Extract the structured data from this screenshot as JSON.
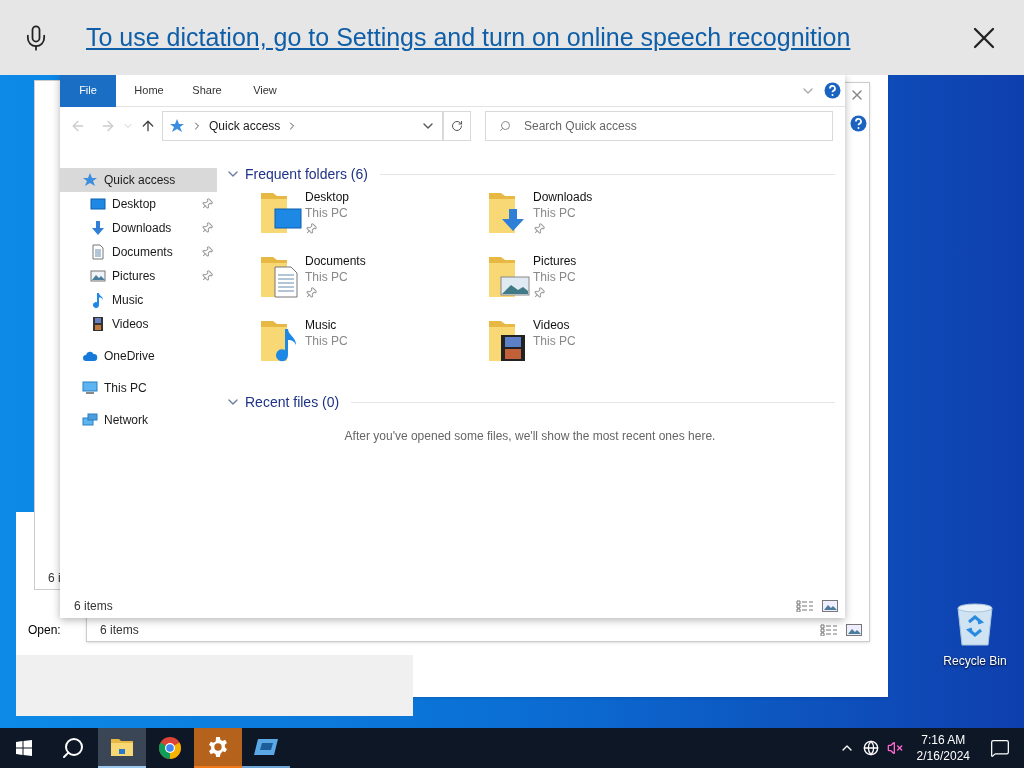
{
  "dictation_bar": {
    "message": "To use dictation, go to Settings and turn on online speech recognition"
  },
  "explorer": {
    "ribbon_tabs": [
      {
        "label": "File",
        "selected": true
      },
      {
        "label": "Home",
        "selected": false
      },
      {
        "label": "Share",
        "selected": false
      },
      {
        "label": "View",
        "selected": false
      }
    ],
    "address": {
      "crumb": "Quick access"
    },
    "search": {
      "placeholder": "Search Quick access"
    },
    "nav": [
      {
        "label": "Quick access",
        "kind": "star",
        "selected": true,
        "children": [
          {
            "label": "Desktop",
            "kind": "desktop",
            "pinned": true,
            "selected": false
          },
          {
            "label": "Downloads",
            "kind": "downloads",
            "pinned": true,
            "selected": false
          },
          {
            "label": "Documents",
            "kind": "documents",
            "pinned": true,
            "selected": false
          },
          {
            "label": "Pictures",
            "kind": "pictures",
            "pinned": true,
            "selected": false
          },
          {
            "label": "Music",
            "kind": "music",
            "pinned": false,
            "selected": false
          },
          {
            "label": "Videos",
            "kind": "videos",
            "pinned": false,
            "selected": false
          }
        ]
      },
      {
        "label": "OneDrive",
        "kind": "cloud",
        "selected": false
      },
      {
        "label": "This PC",
        "kind": "pc",
        "selected": false
      },
      {
        "label": "Network",
        "kind": "network",
        "selected": false
      }
    ],
    "sections": [
      {
        "title": "Frequent folders (6)",
        "expanded": true,
        "folders": [
          {
            "name": "Desktop",
            "location": "This PC",
            "pinned": true,
            "kind": "desktop"
          },
          {
            "name": "Downloads",
            "location": "This PC",
            "pinned": true,
            "kind": "downloads"
          },
          {
            "name": "Documents",
            "location": "This PC",
            "pinned": true,
            "kind": "documents"
          },
          {
            "name": "Pictures",
            "location": "This PC",
            "pinned": true,
            "kind": "pictures"
          },
          {
            "name": "Music",
            "location": "This PC",
            "pinned": false,
            "kind": "music"
          },
          {
            "name": "Videos",
            "location": "This PC",
            "pinned": false,
            "kind": "videos"
          }
        ]
      },
      {
        "title": "Recent files (0)",
        "expanded": true,
        "empty_message": "After you've opened some files, we'll show the most recent ones here."
      }
    ],
    "status": "6 items"
  },
  "back_explorer": {
    "status": "6 items"
  },
  "third_window": {
    "status": "6 i"
  },
  "run_dialog": {
    "open_label": "Open:"
  },
  "desktop_icons": [
    {
      "label": "Recycle Bin"
    }
  ],
  "taskbar": {
    "apps": [
      {
        "kind": "explorer",
        "running": true,
        "active": true,
        "attention": false
      },
      {
        "kind": "chrome",
        "running": false,
        "active": false,
        "attention": false
      },
      {
        "kind": "settings",
        "running": true,
        "active": false,
        "attention": true
      },
      {
        "kind": "app",
        "running": true,
        "active": false,
        "attention": false
      }
    ],
    "time": "7:16 AM",
    "date": "2/16/2024"
  }
}
